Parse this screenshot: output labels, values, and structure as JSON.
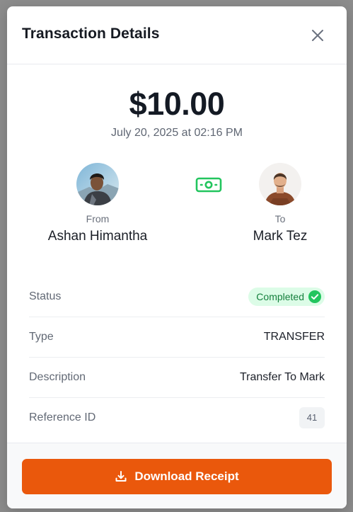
{
  "modal": {
    "title": "Transaction Details",
    "close_icon": "close-icon"
  },
  "transaction": {
    "amount": "$10.00",
    "date": "July 20, 2025 at 02:16 PM"
  },
  "from": {
    "caption": "From",
    "name": "Ashan Himantha"
  },
  "to": {
    "caption": "To",
    "name": "Mark Tez"
  },
  "transfer_icon": "money-icon",
  "details": {
    "status_label": "Status",
    "status_value": "Completed",
    "type_label": "Type",
    "type_value": "TRANSFER",
    "description_label": "Description",
    "description_value": "Transfer To Mark",
    "reference_label": "Reference ID",
    "reference_value": "41"
  },
  "footer": {
    "download_label": "Download Receipt",
    "download_icon": "download-icon"
  },
  "colors": {
    "accent": "#ea580c",
    "success_bg": "#dcfce7",
    "success_text": "#15803d",
    "success_icon": "#22c55e",
    "money_icon": "#22c55e"
  }
}
